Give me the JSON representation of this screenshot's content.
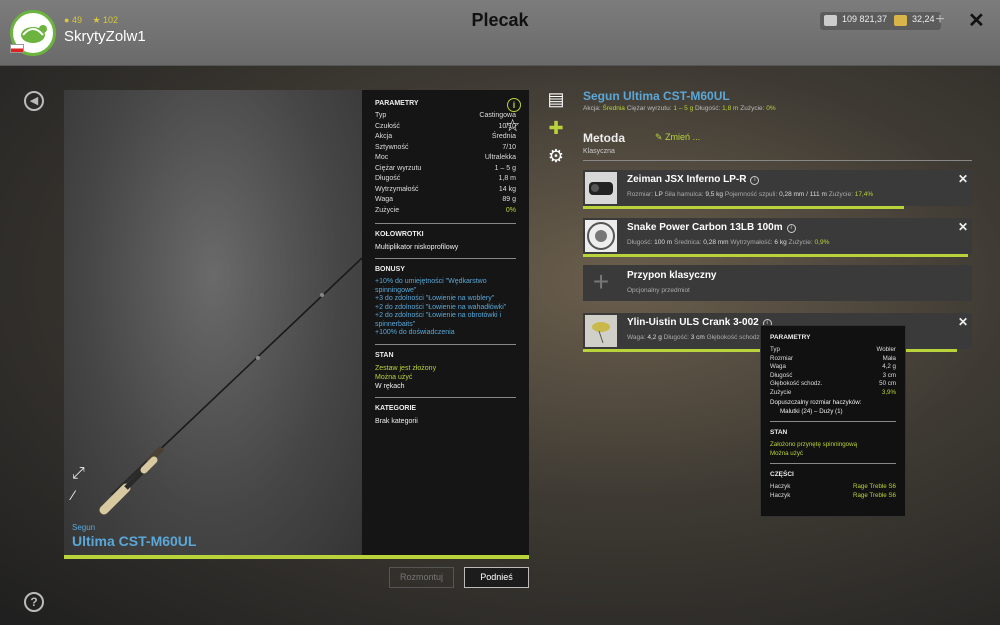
{
  "header": {
    "title": "Plecak",
    "username": "SkrytyZolw1",
    "level": "49",
    "rank": "102",
    "currency_silver": "109 821,37",
    "currency_gold": "32,24",
    "add": "+",
    "close": "✕"
  },
  "preview": {
    "brand": "Segun",
    "model": "Ultima CST-M60UL"
  },
  "params": {
    "heading": "PARAMETRY",
    "rows": [
      {
        "label": "Typ",
        "value": "Castingowa"
      },
      {
        "label": "Czułość",
        "value": "10/10"
      },
      {
        "label": "Akcja",
        "value": "Średnia"
      },
      {
        "label": "Sztywność",
        "value": "7/10"
      },
      {
        "label": "Moc",
        "value": "Ultralekka"
      },
      {
        "label": "Ciężar wyrzutu",
        "value": "1 – 5 g"
      },
      {
        "label": "Długość",
        "value": "1,8 m"
      },
      {
        "label": "Wytrzymałość",
        "value": "14 kg"
      },
      {
        "label": "Waga",
        "value": "89 g"
      },
      {
        "label": "Zużycie",
        "value": "0%"
      }
    ],
    "reels_heading": "KOŁOWROTKI",
    "reels_value": "Multiplikator niskoprofilowy",
    "bonus_heading": "BONUSY",
    "bonuses": [
      "+10% do umiejętności \"Wędkarstwo spinningowe\"",
      "+3 do zdolności \"Łowienie na woblery\"",
      "+2 do zdolności \"Łowienie na wahadłówki\"",
      "+2 do zdolności \"Łowienie na obrotówki i spinnerbaits\"",
      "+100% do doświadczenia"
    ],
    "state_heading": "STAN",
    "states": [
      "Zestaw jest złożony",
      "Można użyć"
    ],
    "state_location": "W rękach",
    "cat_heading": "KATEGORIE",
    "cat_value": "Brak kategorii"
  },
  "buttons": {
    "disassemble": "Rozmontuj",
    "pickup": "Podnieś"
  },
  "right": {
    "title": "Segun Ultima CST-M60UL",
    "sub_label1": "Akcja:",
    "sub_val1": "Średnia",
    "sub_label2": "Ciężar wyrzutu:",
    "sub_val2": "1 – 5 g",
    "sub_label3": "Długość:",
    "sub_val3": "1,8 m",
    "sub_label4": "Zużycie:",
    "sub_val4": "0%",
    "method_label": "Metoda",
    "method_value": "Klasyczna",
    "change": "Zmień ..."
  },
  "slots": {
    "reel": {
      "name": "Zeiman JSX Inferno LP-R",
      "d1l": "Rozmiar:",
      "d1v": "LP",
      "d2l": "Siła hamulca:",
      "d2v": "9,5 kg",
      "d3l": "Pojemność szpuli:",
      "d3v": "0,28 mm / 111 m",
      "d4l": "Zużycie:",
      "d4v": "17,4%",
      "wear": 0.826
    },
    "line": {
      "name": "Snake Power Carbon 13LB 100m",
      "d1l": "Długość:",
      "d1v": "100 m",
      "d2l": "Średnica:",
      "d2v": "0,28 mm",
      "d3l": "Wytrzymałość:",
      "d3v": "6 kg",
      "d4l": "Zużycie:",
      "d4v": "0,9%",
      "wear": 0.991
    },
    "leader": {
      "name": "Przypon klasyczny",
      "sub": "Opcjonalny przedmiot"
    },
    "lure": {
      "name": "Ylin-Uistin ULS Crank 3-002",
      "d1l": "Waga:",
      "d1v": "4,2 g",
      "d2l": "Długość:",
      "d2v": "3 cm",
      "d3l": "Głębokość schodz.",
      "d3v": "",
      "wear": 0.961
    }
  },
  "tooltip": {
    "heading": "PARAMETRY",
    "rows": [
      {
        "label": "Typ",
        "value": "Wobler"
      },
      {
        "label": "Rozmiar",
        "value": "Mała"
      },
      {
        "label": "Waga",
        "value": "4,2 g"
      },
      {
        "label": "Długość",
        "value": "3 cm"
      },
      {
        "label": "Głębokość schodz.",
        "value": "50 cm"
      },
      {
        "label": "Zużycie",
        "value": "3,9%"
      }
    ],
    "hook_size_label": "Dopuszczalny rozmiar haczyków:",
    "hook_size_value": "Malutki (24) – Duży (1)",
    "state_heading": "STAN",
    "states": [
      "Założono przynętę spinningową",
      "Można użyć"
    ],
    "parts_heading": "CZĘŚCI",
    "parts": [
      {
        "label": "Haczyk",
        "value": "Rage Treble S6"
      },
      {
        "label": "Haczyk",
        "value": "Rage Treble S6"
      }
    ]
  }
}
